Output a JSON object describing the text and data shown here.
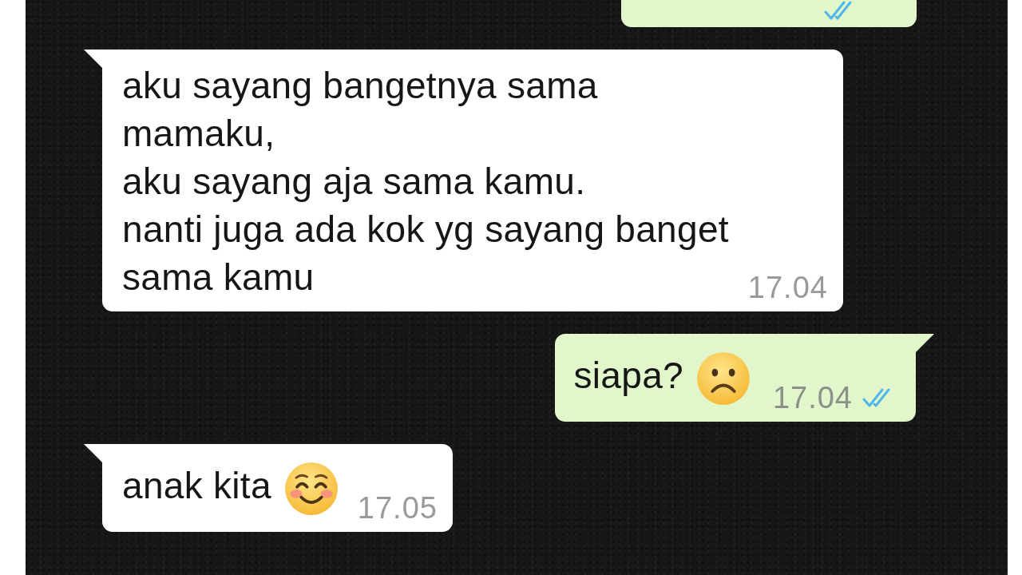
{
  "messages": [
    {
      "kind": "outgoing",
      "cut_off_at_top": true,
      "read": true
    },
    {
      "kind": "incoming",
      "cut_off_at_top": false,
      "text": "aku sayang bangetnya sama\nmamaku,\naku sayang aja sama kamu.\nnanti juga ada kok yg sayang banget\nsama kamu",
      "time": "17.04"
    },
    {
      "kind": "outgoing",
      "cut_off_at_top": false,
      "text": "siapa?",
      "emoji": {
        "kind": "frowning"
      },
      "time": "17.04",
      "read": true
    },
    {
      "kind": "incoming",
      "cut_off_at_top": false,
      "text": "anak kita",
      "emoji": {
        "kind": "smiling"
      },
      "time": "17.05"
    }
  ]
}
